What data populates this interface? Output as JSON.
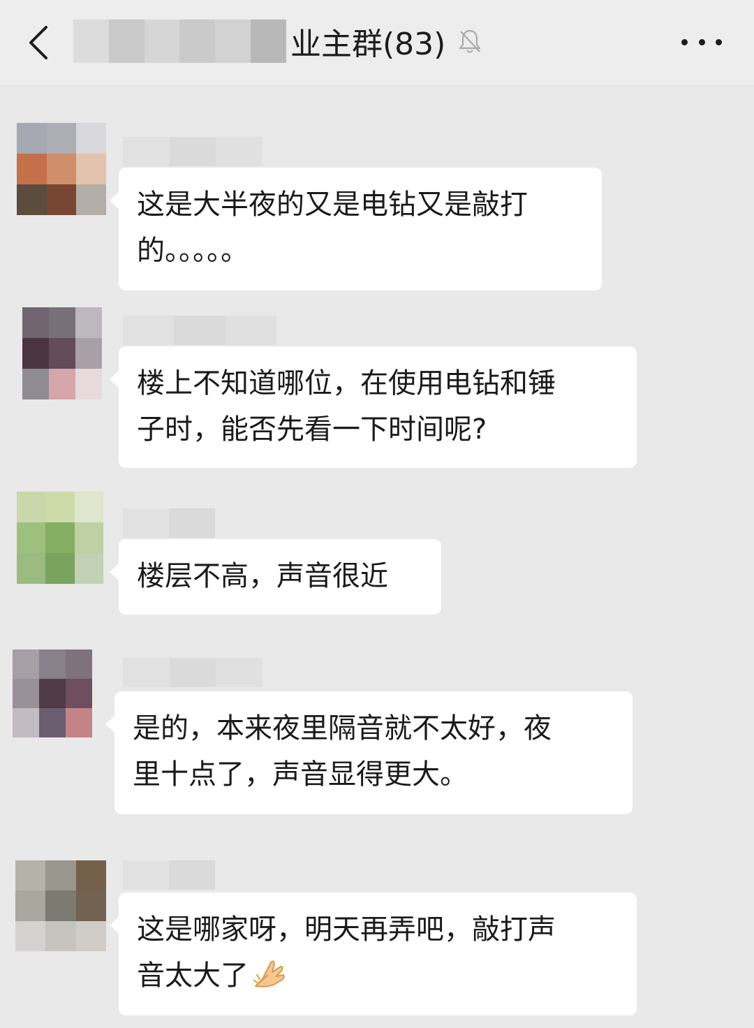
{
  "header": {
    "title": "业主群(83)",
    "back_icon": "chevron-left-icon",
    "mute_icon": "bell-off-icon",
    "more_icon": "more-dots-icon"
  },
  "messages": [
    {
      "lines": [
        "这是大半夜的又是电钻又是敲打",
        "的。。。。。"
      ]
    },
    {
      "lines": [
        "楼上不知道哪位，在使用电钻和锤",
        "子时，能否先看一下时间呢?"
      ]
    },
    {
      "lines": [
        "楼层不高，声音很近"
      ]
    },
    {
      "lines": [
        "是的，本来夜里隔音就不太好，夜",
        "里十点了，声音显得更大。"
      ]
    },
    {
      "lines": [
        "这是哪家呀，明天再弄吧，敲打声",
        "音太大了"
      ],
      "emoji": "praying-hands-icon"
    }
  ],
  "colors": {
    "background": "#e9e9e9",
    "topbar": "#ededed",
    "bubble": "#ffffff"
  }
}
